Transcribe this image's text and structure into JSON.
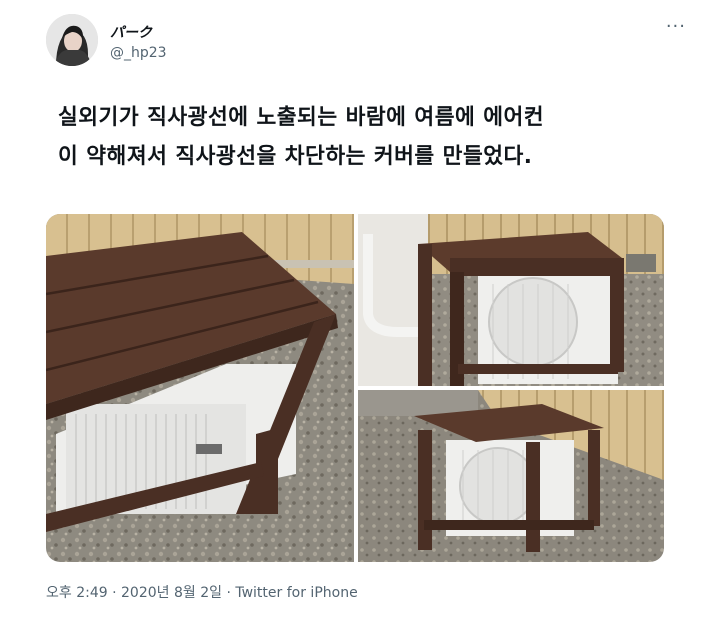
{
  "author": {
    "name": "パーク",
    "handle": "@_hp23",
    "more_label": "···"
  },
  "tweet": {
    "text_line1": "실외기가 직사광선에 노출되는 바람에 여름에 에어컨",
    "text_line2": "이 약해져서 직사광선을 차단하는 커버를 만들었다."
  },
  "meta": {
    "time": "오후 2:49",
    "sep1": " · ",
    "date": "2020년 8월 2일",
    "sep2": " · ",
    "source": "Twitter for iPhone"
  },
  "colors": {
    "text": "#0f1419",
    "secondary": "#536471",
    "wood": "#4a2f24",
    "siding": "#d9c193",
    "gravel": "#8f8a80"
  }
}
